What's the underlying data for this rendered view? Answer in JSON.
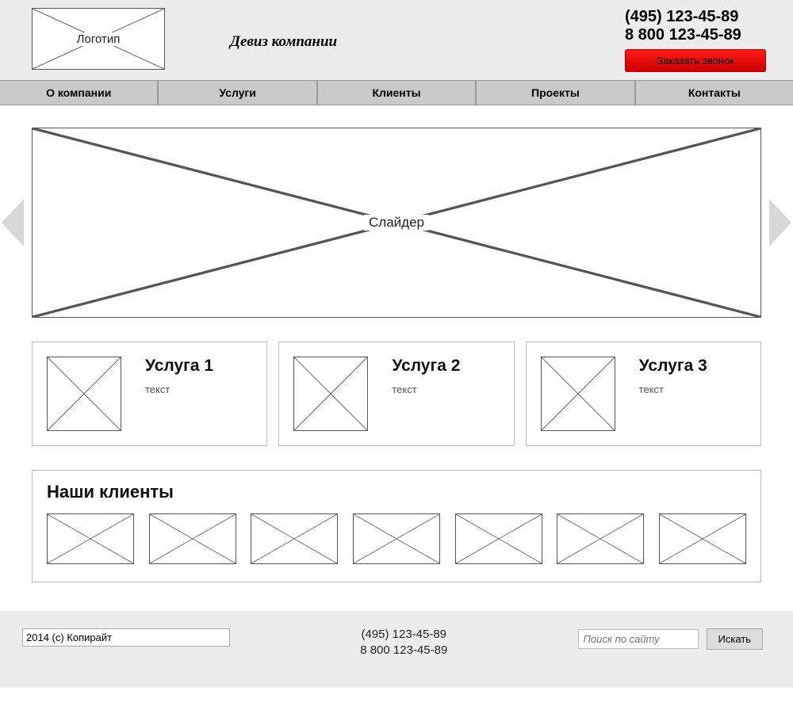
{
  "header": {
    "logo_label": "Логотип",
    "slogan": "Девиз компании",
    "phone1": "(495) 123-45-89",
    "phone2": "8 800 123-45-89",
    "call_button": "Заказать звонок"
  },
  "nav": {
    "items": [
      "О компании",
      "Услуги",
      "Клиенты",
      "Проекты",
      "Контакты"
    ]
  },
  "slider": {
    "label": "Слайдер"
  },
  "services": [
    {
      "title": "Услуга 1",
      "text": "текст"
    },
    {
      "title": "Услуга 2",
      "text": "текст"
    },
    {
      "title": "Услуга 3",
      "text": "текст"
    }
  ],
  "clients": {
    "title": "Наши клиенты",
    "count": 7
  },
  "footer": {
    "copyright": "2014 (c) Копирайт",
    "phone1": "(495) 123-45-89",
    "phone2": "8 800 123-45-89",
    "search_placeholder": "Поиск по сайту",
    "search_button": "Искать"
  }
}
